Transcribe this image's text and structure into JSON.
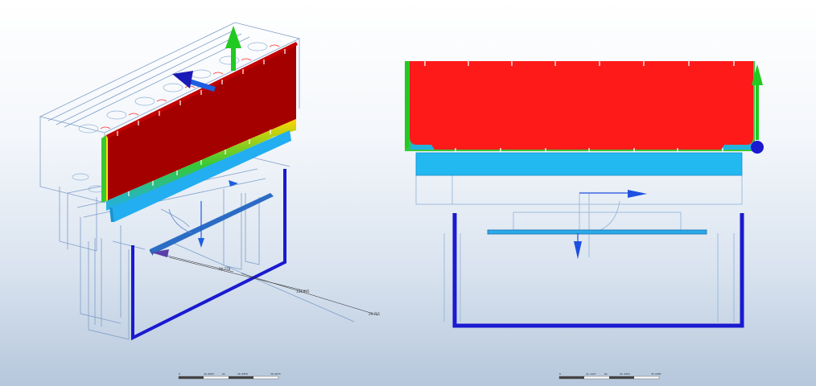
{
  "views": {
    "left": {
      "name": "isometric-view",
      "dimension_labels": [
        "60.778",
        "134.895",
        "29.705"
      ],
      "scale_bar": {
        "labels": [
          "0",
          "10.0025",
          "mm",
          "20.0050",
          "30.0075"
        ]
      }
    },
    "right": {
      "name": "front-view",
      "scale_bar": {
        "labels": [
          "0",
          "11.2127",
          "mm",
          "22.4254",
          "33.6381"
        ]
      }
    }
  },
  "colors": {
    "hot": "#ff1a1a",
    "gradient_mid": "#ffd400",
    "gradient_cool": "#36c936",
    "cool": "#22aef0",
    "frame": "#1a1ad0",
    "wire": "#7f9ec9",
    "axis_up": "#22c922",
    "axis_depth": "#1a1ab8"
  }
}
